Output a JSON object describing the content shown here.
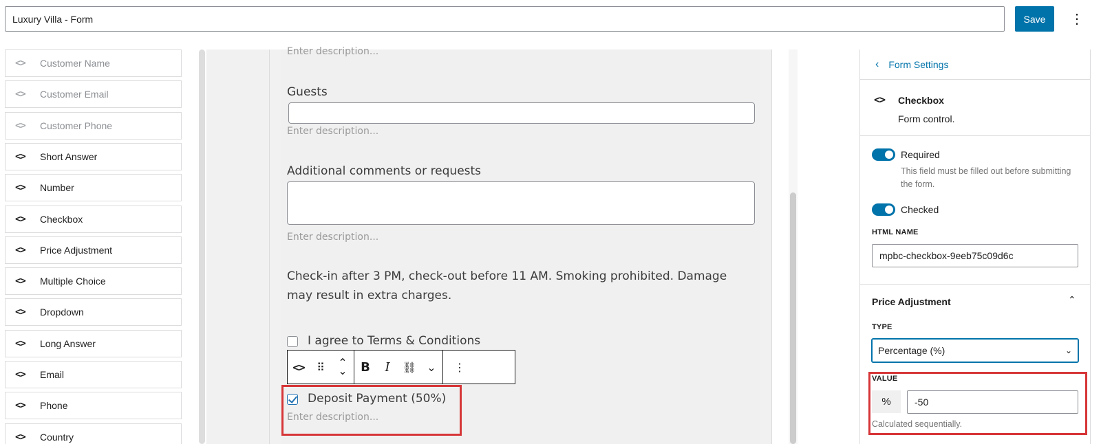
{
  "header": {
    "title_value": "Luxury Villa - Form",
    "save_label": "Save",
    "more_label": "⋮"
  },
  "palette": {
    "items": [
      {
        "label": "Customer Name",
        "dim": true
      },
      {
        "label": "Customer Email",
        "dim": true
      },
      {
        "label": "Customer Phone",
        "dim": true
      },
      {
        "label": "Short Answer",
        "dim": false
      },
      {
        "label": "Number",
        "dim": false
      },
      {
        "label": "Checkbox",
        "dim": false
      },
      {
        "label": "Price Adjustment",
        "dim": false
      },
      {
        "label": "Multiple Choice",
        "dim": false
      },
      {
        "label": "Dropdown",
        "dim": false
      },
      {
        "label": "Long Answer",
        "dim": false
      },
      {
        "label": "Email",
        "dim": false
      },
      {
        "label": "Phone",
        "dim": false
      },
      {
        "label": "Country",
        "dim": false
      }
    ],
    "icon_glyph": "<>"
  },
  "canvas": {
    "desc_top": "Enter description...",
    "guests_label": "Guests",
    "guests_desc": "Enter description...",
    "comments_label": "Additional comments or requests",
    "comments_desc": "Enter description...",
    "policy_text": "Check-in after 3 PM, check-out before 11 AM. Smoking prohibited. Damage may result in extra charges.",
    "terms_label": "I agree to Terms & Conditions",
    "deposit_label": "Deposit Payment (50%)",
    "deposit_desc": "Enter description..."
  },
  "toolbar": {
    "block_icon": "<>",
    "drag_icon": "⠿",
    "move_up": "⌃",
    "move_down": "⌄",
    "bold": "B",
    "italic": "I",
    "link": "⛓",
    "more_rich": "⌄",
    "options": "⋮"
  },
  "sidebar": {
    "back_label": "Form Settings",
    "block_name": "Checkbox",
    "block_desc": "Form control.",
    "required_label": "Required",
    "required_help": "This field must be filled out before submitting the form.",
    "checked_label": "Checked",
    "html_name_caption": "HTML NAME",
    "html_name_value": "mpbc-checkbox-9eeb75c09d6c",
    "price_section": "Price Adjustment",
    "type_caption": "TYPE",
    "type_value": "Percentage (%)",
    "value_caption": "VALUE",
    "value_unit": "%",
    "value_value": "-50",
    "value_help": "Calculated sequentially."
  },
  "colors": {
    "accent": "#0073aa",
    "highlight": "#d63638"
  }
}
